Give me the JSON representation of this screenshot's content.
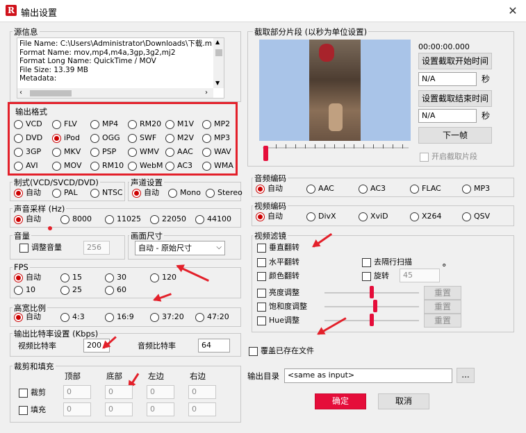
{
  "window": {
    "title": "输出设置",
    "close": "✕"
  },
  "source_info": {
    "label": "源信息",
    "lines": [
      "File Name: C:\\Users\\Administrator\\Downloads\\下载.mp4",
      "Format Name: mov,mp4,m4a,3gp,3g2,mj2",
      "Format Long Name: QuickTime / MOV",
      "File Size: 13.39 MB",
      "Metadata:"
    ]
  },
  "output_format": {
    "label": "输出格式",
    "selected": "iPod",
    "options": [
      "VCD",
      "FLV",
      "MP4",
      "RM20",
      "M1V",
      "MP2",
      "DVD",
      "iPod",
      "OGG",
      "SWF",
      "M2V",
      "MP3",
      "3GP",
      "MKV",
      "PSP",
      "WMV",
      "AAC",
      "WAV",
      "AVI",
      "MOV",
      "RM10",
      "WebM",
      "AC3",
      "WMA"
    ]
  },
  "tv_standard": {
    "label": "制式(VCD/SVCD/DVD)",
    "options": [
      "自动",
      "PAL",
      "NTSC"
    ],
    "selected": "自动"
  },
  "channel": {
    "label": "声道设置",
    "options": [
      "自动",
      "Mono",
      "Stereo"
    ],
    "selected": "自动"
  },
  "sample_rate": {
    "label": "声音采样 (Hz)",
    "options": [
      "自动",
      "8000",
      "11025",
      "22050",
      "44100"
    ],
    "selected": "自动"
  },
  "volume": {
    "label": "音量",
    "checkbox": "调整音量",
    "value": "256"
  },
  "frame_size": {
    "label": "画面尺寸",
    "value": "自动 - 原始尺寸"
  },
  "fps": {
    "label": "FPS",
    "options": [
      "自动",
      "15",
      "30",
      "120",
      "10",
      "25",
      "60"
    ],
    "selected": "自动"
  },
  "aspect": {
    "label": "高宽比例",
    "options": [
      "自动",
      "4:3",
      "16:9",
      "37:20",
      "47:20"
    ],
    "selected": "自动"
  },
  "bitrate": {
    "label": "输出比特率设置 (Kbps)",
    "video_label": "视频比特率",
    "video_value": "200",
    "audio_label": "音频比特率",
    "audio_value": "64"
  },
  "crop": {
    "label": "裁剪和填充",
    "headers": [
      "顶部",
      "底部",
      "左边",
      "右边"
    ],
    "rows": [
      {
        "label": "裁剪",
        "values": [
          "0",
          "0",
          "0",
          "0"
        ]
      },
      {
        "label": "填充",
        "values": [
          "0",
          "0",
          "0",
          "0"
        ]
      }
    ]
  },
  "clip": {
    "label": "截取部分片段 (以秒为单位设置)",
    "time": "00:00:00.000",
    "set_start": "设置截取开始时间",
    "start_value": "N/A",
    "set_end": "设置截取结束时间",
    "end_value": "N/A",
    "sec": "秒",
    "next_frame": "下一帧",
    "enable": "开启截取片段"
  },
  "audio_codec": {
    "label": "音频编码",
    "options": [
      "自动",
      "AAC",
      "AC3",
      "FLAC",
      "MP3"
    ],
    "selected": "自动"
  },
  "video_codec": {
    "label": "视频编码",
    "options": [
      "自动",
      "DivX",
      "XviD",
      "X264",
      "QSV"
    ],
    "selected": "自动"
  },
  "video_filter": {
    "label": "视频滤镜",
    "vflip": "垂直翻转",
    "hflip": "水平翻转",
    "deinterlace": "去隔行扫描",
    "color_flip": "颜色翻转",
    "rotate": "旋转",
    "rotate_value": "45",
    "degree": "°",
    "brightness": "亮度调整",
    "saturation": "饱和度调整",
    "hue": "Hue调整",
    "reset": "重置"
  },
  "overwrite": "覆盖已存在文件",
  "output_dir": {
    "label": "输出目录",
    "value": "<same as input>",
    "browse": "..."
  },
  "ok": "确定",
  "cancel": "取消"
}
